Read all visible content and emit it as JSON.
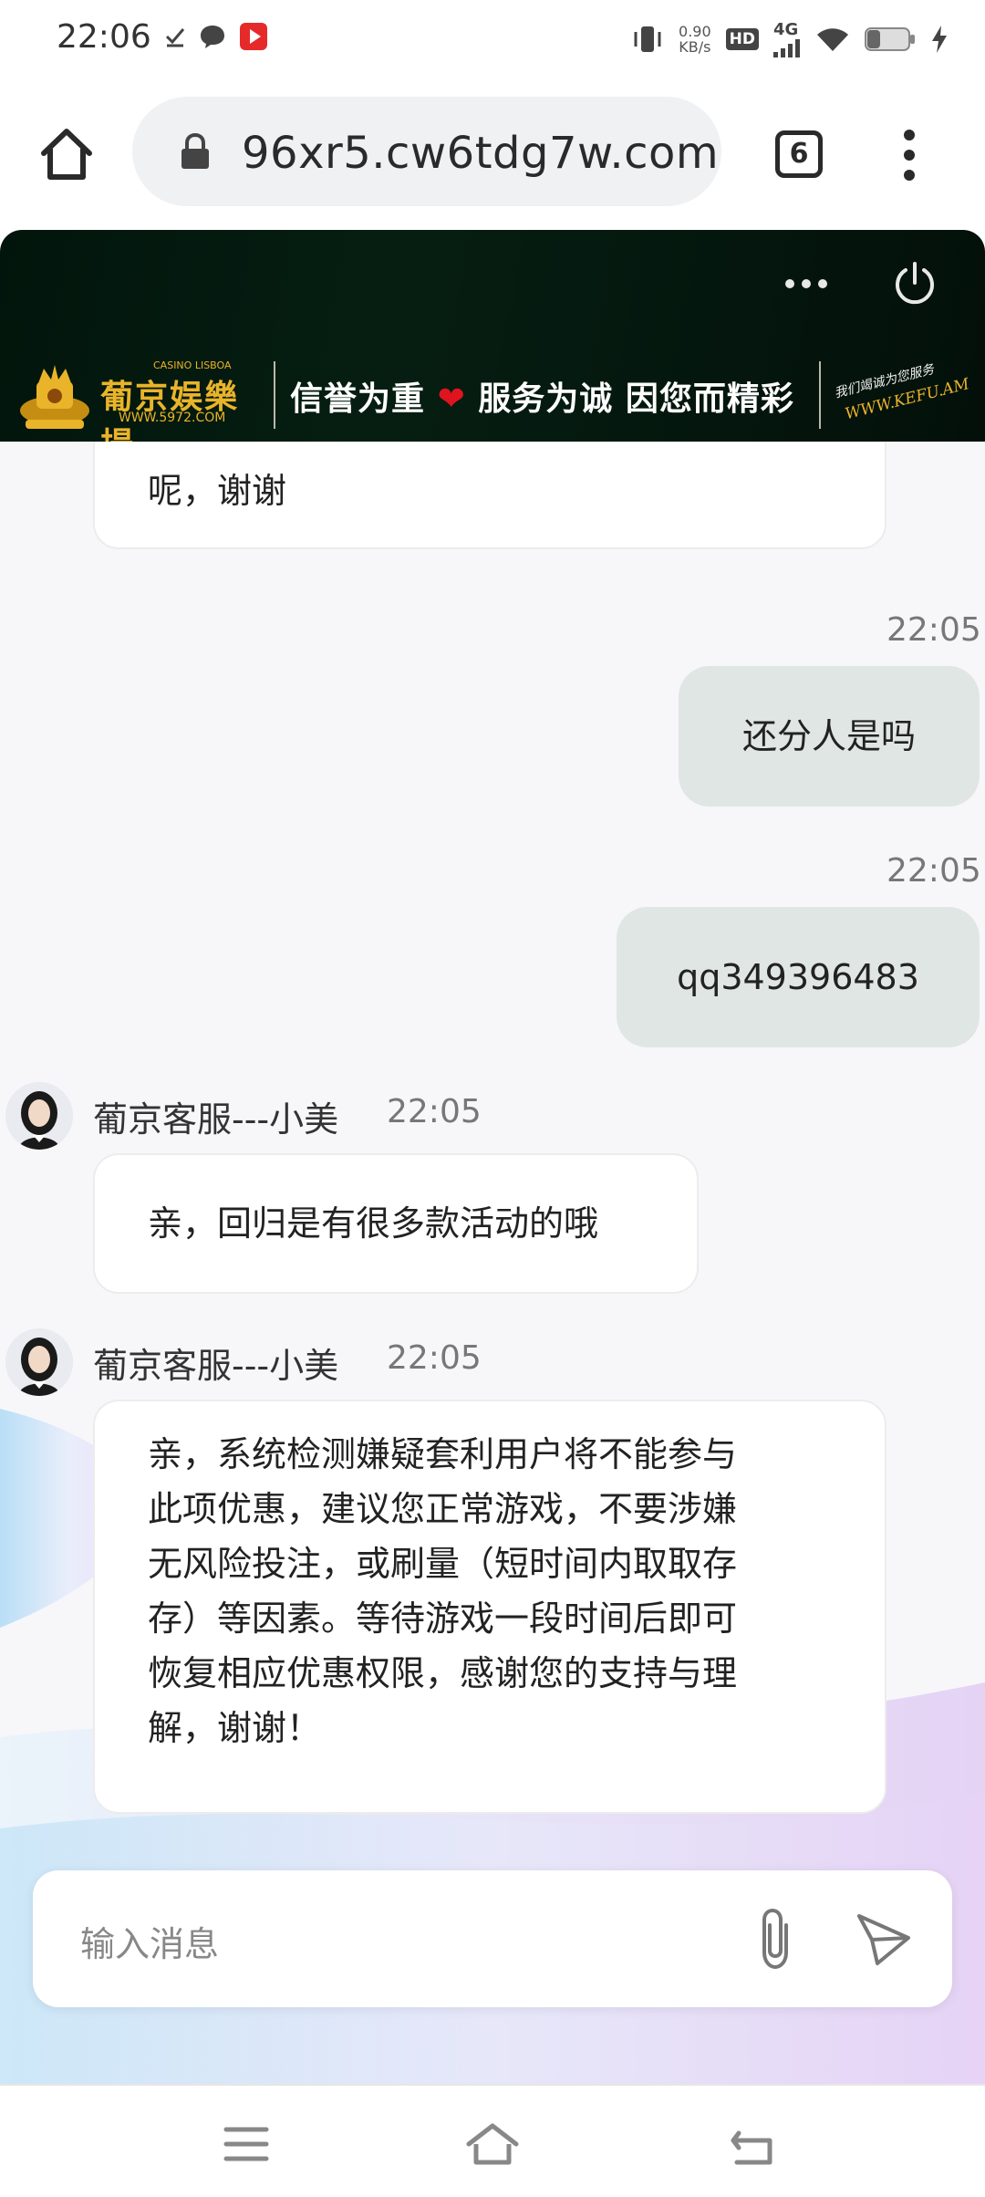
{
  "status_bar": {
    "time": "22:06",
    "net_speed_value": "0.90",
    "net_speed_unit": "KB/s",
    "hd_badge": "HD",
    "network": "4G",
    "icons": [
      "check-icon",
      "chat-bubble-icon",
      "video-app-icon",
      "vibrate-icon",
      "signal-icon",
      "wifi-icon",
      "battery-icon",
      "charging-icon"
    ]
  },
  "browser": {
    "url": "96xr5.cw6tdg7w.com",
    "tab_count": "6",
    "icons": [
      "home-icon",
      "lock-icon",
      "menu-dots-icon"
    ]
  },
  "banner": {
    "logo_cn": "葡京娱樂場",
    "logo_en": "CASINO LISBOA",
    "logo_url": "WWW.5972.COM",
    "slogan_part1": "信誉为重",
    "slogan_part2": "服务为诚  因您而精彩",
    "kefu_cn": "我们竭诚为您服务",
    "kefu_en": "WWW.KEFU.AM",
    "icons": [
      "more-dots-icon",
      "power-icon",
      "heart-icon"
    ]
  },
  "chat": {
    "partial_message": "呢，谢谢",
    "outgoing": [
      {
        "time": "22:05",
        "text": "还分人是吗"
      },
      {
        "time": "22:05",
        "text": "qq349396483"
      }
    ],
    "incoming": [
      {
        "sender": "葡京客服---小美",
        "time": "22:05",
        "text": "亲，回归是有很多款活动的哦"
      },
      {
        "sender": "葡京客服---小美",
        "time": "22:05",
        "lines": [
          "亲，系统检测嫌疑套利用户将不能参与",
          "此项优惠，建议您正常游戏，不要涉嫌",
          "无风险投注，或刷量（短时间内取取存",
          "存）等因素。等待游戏一段时间后即可",
          "恢复相应优惠权限，感谢您的支持与理",
          "解，谢谢！"
        ]
      }
    ]
  },
  "input": {
    "placeholder": "输入消息",
    "icons": [
      "attachment-icon",
      "send-icon"
    ]
  },
  "nav_bar": {
    "icons": [
      "recent-apps-icon",
      "home-icon",
      "back-icon"
    ]
  }
}
